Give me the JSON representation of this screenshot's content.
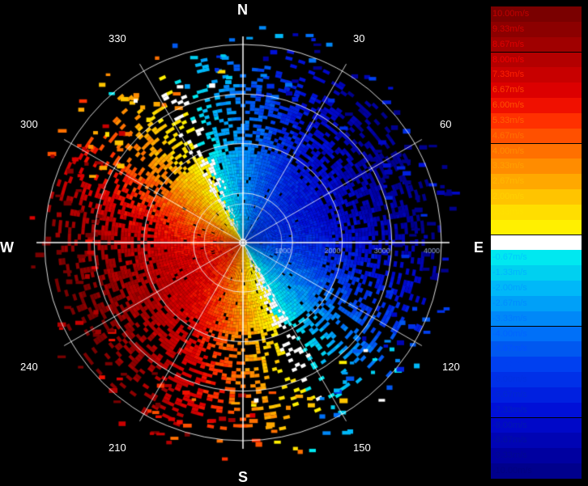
{
  "chart_data": {
    "type": "heatmap",
    "title": "",
    "compass": {
      "north": "N",
      "east": "E",
      "south": "S",
      "west": "W"
    },
    "azimuth_labels": [
      "30",
      "60",
      "120",
      "150",
      "210",
      "240",
      "300",
      "330"
    ],
    "range_rings_m": [
      1000,
      2000,
      3000,
      4000
    ],
    "range_ring_labels": [
      "1000",
      "2000",
      "3000",
      "4000"
    ],
    "colorbar": {
      "unit": "m/s",
      "labels": [
        "10.00m/s",
        "9.33m/s",
        "8.67m/s",
        "8.00m/s",
        "7.33m/s",
        "6.67m/s",
        "6.00m/s",
        "5.33m/s",
        "4.67m/s",
        "4.00m/s",
        "3.33m/s",
        "2.67m/s",
        "2.00m/s",
        "1.33m/s",
        "0.67m/s",
        "0.00m/s",
        "-0.67m/s",
        "-1.33m/s",
        "-2.00m/s",
        "-2.67m/s",
        "-3.33m/s",
        "-4.00m/s",
        "-4.67m/s",
        "-5.33m/s",
        "-6.00m/s",
        "-6.67m/s",
        "-7.33m/s",
        "-8.00m/s",
        "-8.67m/s",
        "-9.33m/s",
        "-10.00m/s"
      ],
      "colors": [
        "#7a0000",
        "#8c0000",
        "#a00000",
        "#b40000",
        "#c80000",
        "#dc0000",
        "#f01000",
        "#ff3000",
        "#ff5000",
        "#ff7000",
        "#ff8c00",
        "#ffa800",
        "#ffc400",
        "#ffde00",
        "#fff000",
        "#ffffff",
        "#00e8f0",
        "#00d0f0",
        "#00b8f8",
        "#00a0f8",
        "#0088f8",
        "#0070f8",
        "#0058f0",
        "#0040f0",
        "#0030e8",
        "#0020e0",
        "#0010d8",
        "#0008c8",
        "#0004b4",
        "#0000a0",
        "#00008c"
      ],
      "label_colors": [
        "#c00000",
        "#d00000",
        "#e00000",
        "#f00000",
        "#ff2000",
        "#ff4000",
        "#ff5000",
        "#ff6000",
        "#ff7000",
        "#ff8c00",
        "#ffa000",
        "#ffb800",
        "#ffd000",
        "#ffe000",
        "#fff000",
        "#ffffff",
        "#00c8ff",
        "#00b4ff",
        "#00a0ff",
        "#008cff",
        "#0078ff",
        "#0064ff",
        "#0050ff",
        "#0040f0",
        "#0030e0",
        "#0028d0",
        "#0020c0",
        "#0018b0",
        "#0010a0",
        "#000890",
        "#000080"
      ]
    },
    "velocity_range": [
      -10,
      10
    ],
    "wind_direction_deg": 245,
    "vmax_ms": 10.0
  }
}
